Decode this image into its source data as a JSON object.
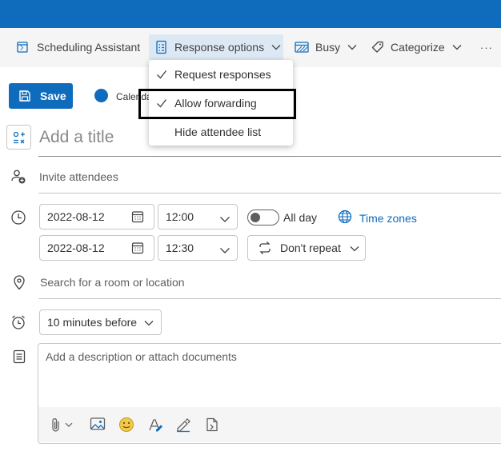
{
  "toolbar": {
    "scheduling_assistant": "Scheduling Assistant",
    "response_options": "Response options",
    "busy": "Busy",
    "categorize": "Categorize",
    "more": "···"
  },
  "response_menu": {
    "items": [
      {
        "label": "Request responses",
        "checked": true
      },
      {
        "label": "Allow forwarding",
        "checked": true,
        "highlighted": true
      },
      {
        "label": "Hide attendee list",
        "checked": false
      }
    ]
  },
  "save_label": "Save",
  "calendar_label": "Calendar",
  "title_placeholder": "Add a title",
  "invite_placeholder": "Invite attendees",
  "start": {
    "date": "2022-08-12",
    "time": "12:00"
  },
  "end": {
    "date": "2022-08-12",
    "time": "12:30"
  },
  "all_day_label": "All day",
  "all_day_on": false,
  "time_zones_label": "Time zones",
  "repeat_label": "Don't repeat",
  "location_placeholder": "Search for a room or location",
  "reminder_label": "10 minutes before",
  "description_placeholder": "Add a description or attach documents",
  "colors": {
    "accent": "#0f6cbd",
    "toolbar_bg": "#f5f5f5",
    "active_bg": "#dde8f5",
    "highlight": "#000000"
  },
  "icons": [
    "scheduling-icon",
    "response-options-icon",
    "busy-icon",
    "tag-icon",
    "save-icon",
    "title-icon",
    "people-add-icon",
    "clock-icon",
    "calendar-icon",
    "globe-icon",
    "repeat-icon",
    "location-icon",
    "alarm-icon",
    "notes-icon",
    "attach-icon",
    "image-icon",
    "emoji-icon",
    "format-icon",
    "signature-icon",
    "loop-icon"
  ]
}
